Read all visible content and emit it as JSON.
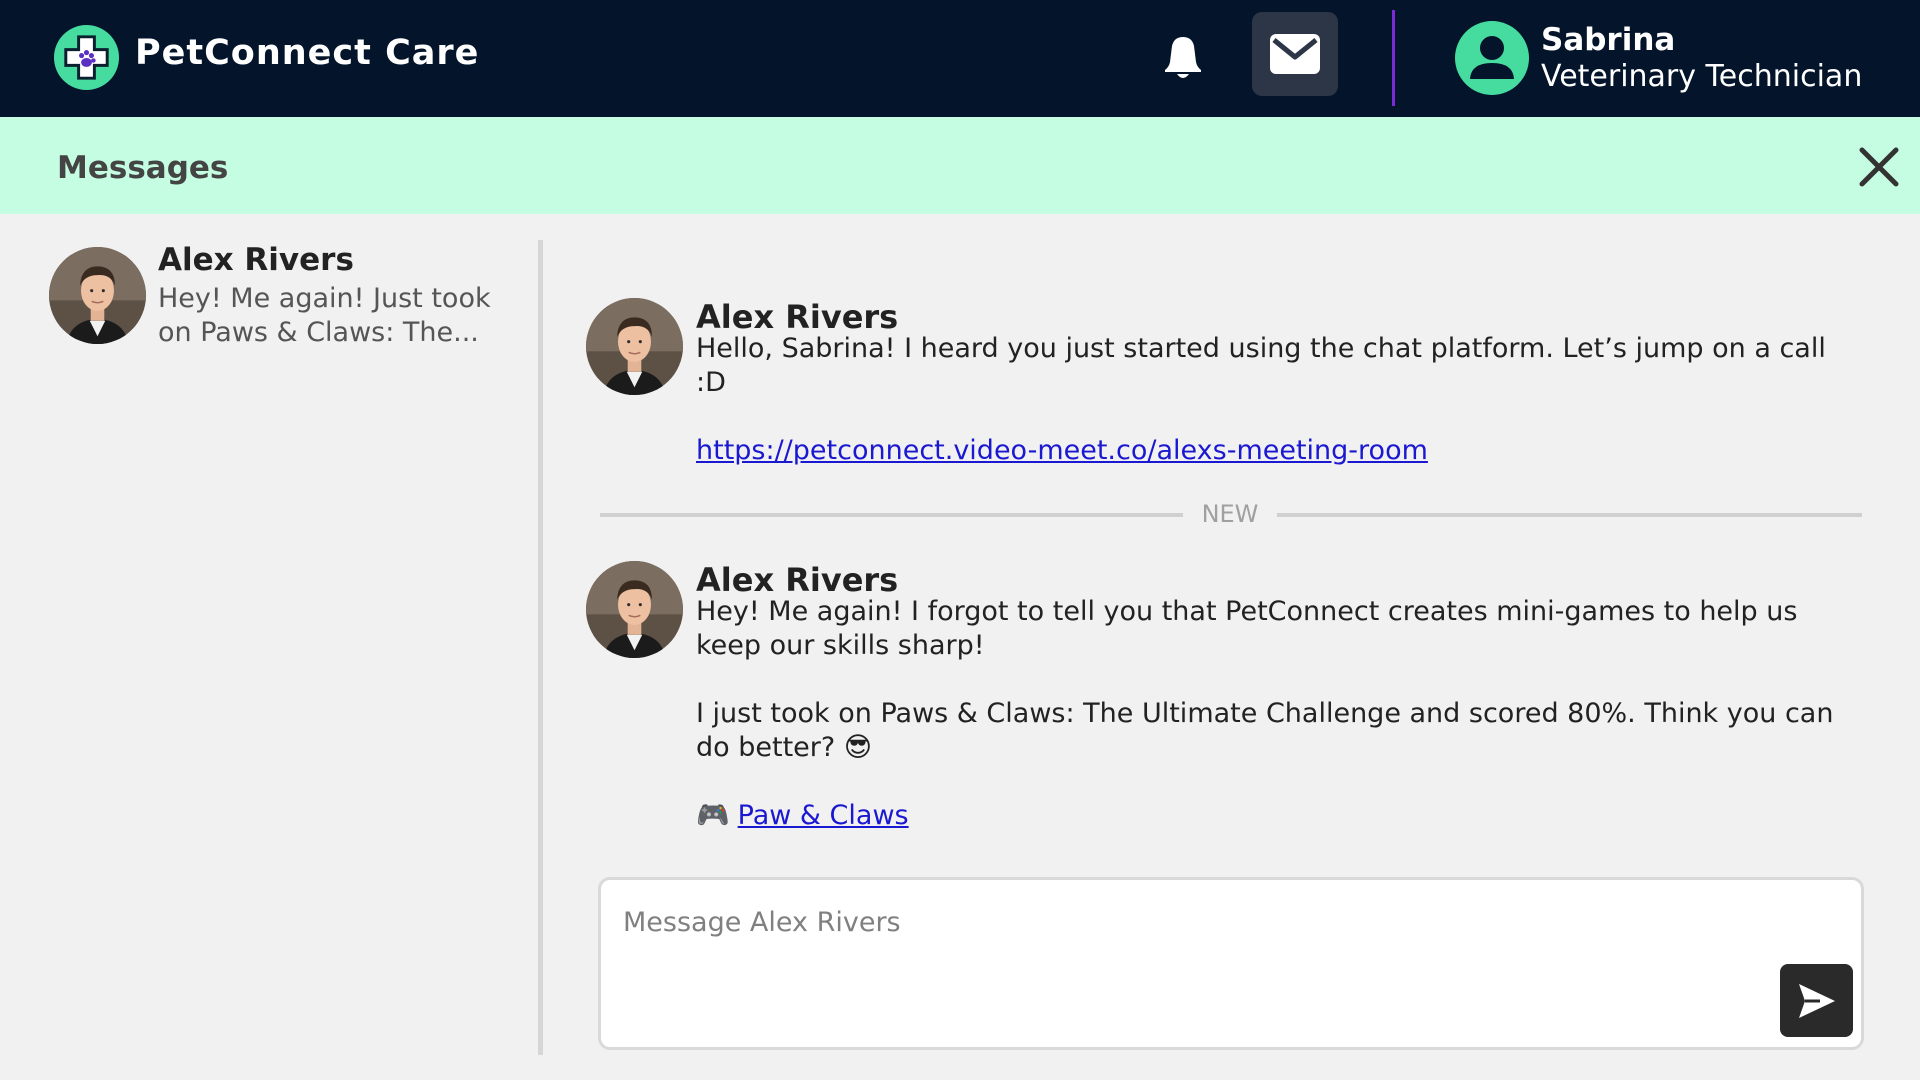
{
  "header": {
    "brand": "PetConnect Care",
    "user": {
      "name": "Sabrina",
      "role": "Veterinary Technician"
    },
    "icons": [
      "paw-cross-logo-icon",
      "bell-icon",
      "mail-icon",
      "user-icon"
    ]
  },
  "subheader": {
    "title": "Messages",
    "close_icon": "close-icon"
  },
  "conversations": [
    {
      "name": "Alex Rivers",
      "preview": "Hey! Me again! Just took on Paws & Claws: The..."
    }
  ],
  "messages": [
    {
      "author": "Alex Rivers",
      "paragraphs": [
        "Hello, Sabrina! I heard you just started using the chat platform. Let’s jump on a call :D"
      ],
      "link": "https://petconnect.video-meet.co/alexs-meeting-room"
    },
    {
      "author": "Alex Rivers",
      "paragraphs": [
        "Hey! Me again! I forgot to tell you that PetConnect creates mini-games to help us keep our skills sharp!",
        "I just took on Paws & Claws: The Ultimate Challenge and scored 80%. Think you can do better?"
      ],
      "emoji": "😎",
      "game_icon": "🎮",
      "game_link": "Paw & Claws"
    }
  ],
  "separator": {
    "label": "NEW"
  },
  "composer": {
    "placeholder": "Message Alex Rivers",
    "send_icon": "send-icon"
  },
  "colors": {
    "header_bg": "#03142b",
    "subheader_bg": "#c5fde3",
    "accent_green": "#46dca0",
    "divider_purple": "#7a2bd6",
    "link": "#1a18d0"
  }
}
